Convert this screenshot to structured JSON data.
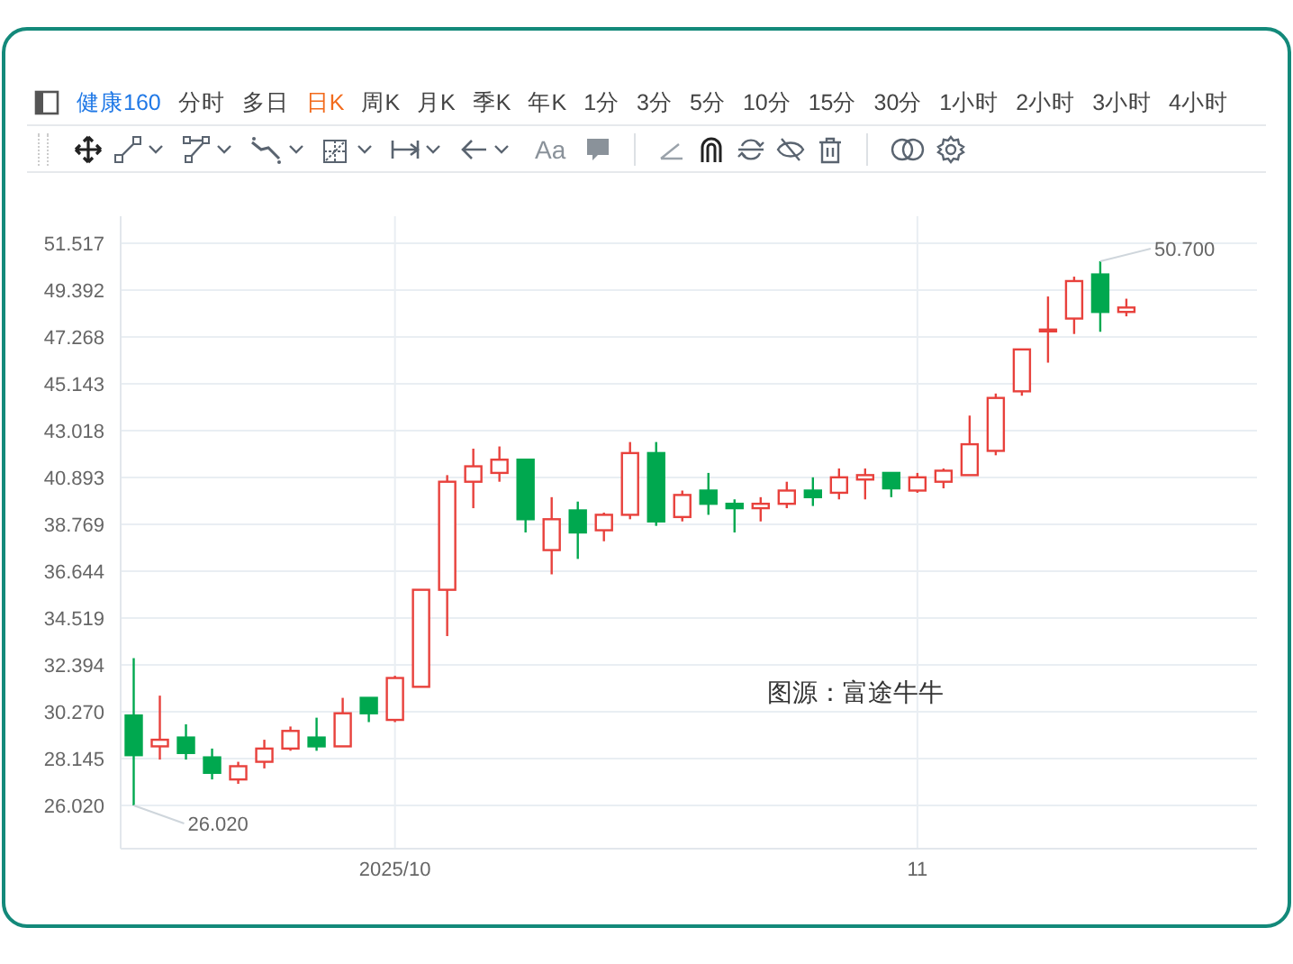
{
  "toolbar": {
    "stock_name": "健康160",
    "periods": [
      {
        "label": "分时",
        "selected": false
      },
      {
        "label": "多日",
        "selected": false
      },
      {
        "label": "日K",
        "selected": true
      },
      {
        "label": "周K",
        "selected": false
      },
      {
        "label": "月K",
        "selected": false
      },
      {
        "label": "季K",
        "selected": false
      },
      {
        "label": "年K",
        "selected": false
      },
      {
        "label": "1分",
        "selected": false
      },
      {
        "label": "3分",
        "selected": false
      },
      {
        "label": "5分",
        "selected": false
      },
      {
        "label": "10分",
        "selected": false
      },
      {
        "label": "15分",
        "selected": false
      },
      {
        "label": "30分",
        "selected": false
      },
      {
        "label": "1小时",
        "selected": false
      },
      {
        "label": "2小时",
        "selected": false
      },
      {
        "label": "3小时",
        "selected": false
      },
      {
        "label": "4小时",
        "selected": false
      }
    ],
    "text_tool": "Aa"
  },
  "chart": {
    "chart_data": {
      "type": "candlestick",
      "grid": true,
      "categories": [
        null,
        null,
        null,
        null,
        null,
        null,
        null,
        null,
        null,
        null,
        "2025/10",
        null,
        null,
        null,
        null,
        null,
        null,
        null,
        null,
        null,
        null,
        null,
        null,
        null,
        null,
        null,
        null,
        null,
        null,
        null,
        "11",
        null,
        null,
        null,
        null,
        null,
        null,
        null,
        null
      ],
      "ylim": [
        24.06,
        52.74
      ],
      "yticks": [
        {
          "value": 51.517,
          "label": "51.517"
        },
        {
          "value": 49.392,
          "label": "49.392"
        },
        {
          "value": 47.268,
          "label": "47.268"
        },
        {
          "value": 45.143,
          "label": "45.143"
        },
        {
          "value": 43.018,
          "label": "43.018"
        },
        {
          "value": 40.893,
          "label": "40.893"
        },
        {
          "value": 38.769,
          "label": "38.769"
        },
        {
          "value": 36.644,
          "label": "36.644"
        },
        {
          "value": 34.519,
          "label": "34.519"
        },
        {
          "value": 32.394,
          "label": "32.394"
        },
        {
          "value": 30.27,
          "label": "30.270"
        },
        {
          "value": 28.145,
          "label": "28.145"
        },
        {
          "value": 26.02,
          "label": "26.020"
        }
      ],
      "ohlc": [
        [
          30.1,
          32.7,
          26.02,
          28.3
        ],
        [
          28.7,
          31.0,
          28.1,
          29.0
        ],
        [
          29.1,
          29.7,
          28.1,
          28.4
        ],
        [
          28.2,
          28.6,
          27.2,
          27.5
        ],
        [
          27.2,
          28.0,
          27.0,
          27.8
        ],
        [
          28.0,
          29.0,
          27.7,
          28.6
        ],
        [
          28.6,
          29.6,
          28.5,
          29.4
        ],
        [
          29.1,
          30.0,
          28.5,
          28.7
        ],
        [
          28.7,
          30.9,
          28.7,
          30.2
        ],
        [
          30.9,
          30.9,
          29.8,
          30.2
        ],
        [
          29.9,
          31.9,
          29.8,
          31.8
        ],
        [
          31.4,
          35.8,
          31.4,
          35.8
        ],
        [
          35.8,
          41.0,
          33.7,
          40.7
        ],
        [
          40.7,
          42.2,
          39.5,
          41.4
        ],
        [
          41.1,
          42.3,
          40.7,
          41.7
        ],
        [
          41.7,
          41.7,
          38.4,
          39.0
        ],
        [
          37.6,
          40.0,
          36.5,
          39.0
        ],
        [
          39.4,
          39.8,
          37.2,
          38.4
        ],
        [
          38.5,
          39.3,
          38.0,
          39.2
        ],
        [
          39.2,
          42.5,
          39.0,
          42.0
        ],
        [
          42.0,
          42.5,
          38.7,
          38.9
        ],
        [
          39.1,
          40.3,
          38.9,
          40.1
        ],
        [
          40.3,
          41.1,
          39.2,
          39.7
        ],
        [
          39.7,
          39.9,
          38.4,
          39.5
        ],
        [
          39.5,
          40.0,
          38.9,
          39.7
        ],
        [
          39.7,
          40.7,
          39.5,
          40.3
        ],
        [
          40.3,
          40.9,
          39.6,
          40.0
        ],
        [
          40.2,
          41.3,
          39.9,
          40.9
        ],
        [
          40.8,
          41.3,
          39.9,
          41.0
        ],
        [
          41.1,
          41.1,
          40.0,
          40.4
        ],
        [
          40.3,
          41.1,
          40.2,
          40.9
        ],
        [
          40.7,
          41.3,
          40.4,
          41.2
        ],
        [
          41.0,
          43.7,
          41.0,
          42.4
        ],
        [
          42.1,
          44.7,
          41.9,
          44.5
        ],
        [
          44.8,
          46.7,
          44.6,
          46.7
        ],
        [
          47.6,
          49.1,
          46.1,
          47.6
        ],
        [
          48.1,
          50.0,
          47.4,
          49.8
        ],
        [
          50.1,
          50.7,
          47.5,
          48.4
        ],
        [
          48.4,
          49.0,
          48.2,
          48.6
        ]
      ],
      "annotations": [
        "50.700",
        "26.020"
      ]
    },
    "source_caption": "图源：富途牛牛"
  }
}
